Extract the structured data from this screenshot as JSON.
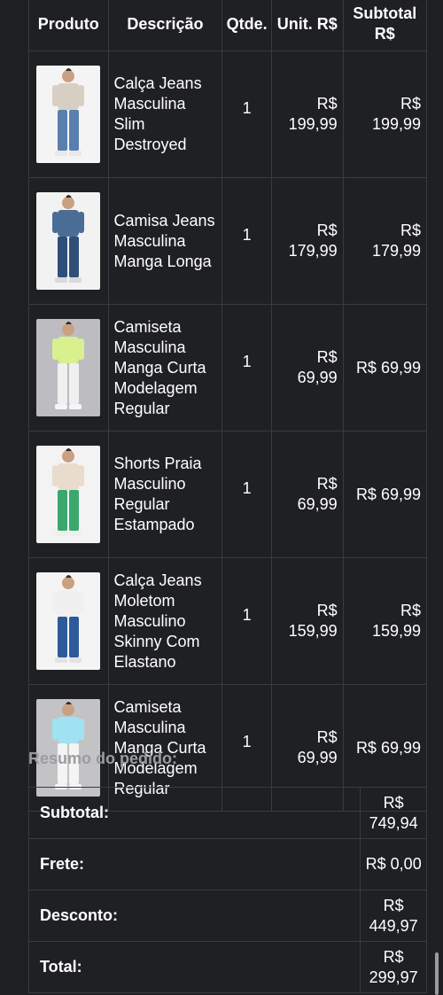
{
  "table": {
    "headers": {
      "product": "Produto",
      "description": "Descrição",
      "quantity": "Qtde.",
      "unit": "Unit. R$",
      "subtotal": "Subtotal R$"
    },
    "rows": [
      {
        "description": "Calça Jeans Masculina Slim Destroyed",
        "quantity": "1",
        "unit": "R$ 199,99",
        "subtotal": "R$ 199,99",
        "thumb": {
          "bg": "#f4f4f4",
          "top": "#d8cfc4",
          "bottom": "#5a7fae",
          "shoes": "#e8e8e8"
        }
      },
      {
        "description": "Camisa Jeans Masculina Manga Longa",
        "quantity": "1",
        "unit": "R$ 179,99",
        "subtotal": "R$ 179,99",
        "thumb": {
          "bg": "#f2f2f2",
          "top": "#4a6d95",
          "bottom": "#2f4f7a",
          "shoes": "#d9d9d9"
        }
      },
      {
        "description": "Camiseta Masculina Manga Curta Modelagem Regular",
        "quantity": "1",
        "unit": "R$ 69,99",
        "subtotal": "R$ 69,99",
        "thumb": {
          "bg": "#bdbdc1",
          "top": "#d9f08f",
          "bottom": "#f0f0f0",
          "shoes": "#f5f5f5"
        }
      },
      {
        "description": "Shorts Praia Masculino Regular Estampado",
        "quantity": "1",
        "unit": "R$ 69,99",
        "subtotal": "R$ 69,99",
        "thumb": {
          "bg": "#f3f3f3",
          "top": "#e9dccd",
          "bottom": "#3aa86c",
          "shoes": "#eeeeee"
        }
      },
      {
        "description": "Calça Jeans Moletom Masculino Skinny Com Elastano",
        "quantity": "1",
        "unit": "R$ 159,99",
        "subtotal": "R$ 159,99",
        "thumb": {
          "bg": "#f4f4f4",
          "top": "#f0f0f0",
          "bottom": "#2e5a9c",
          "shoes": "#e3e3e3"
        }
      },
      {
        "description": "Camiseta Masculina Manga Curta Modelagem Regular",
        "quantity": "1",
        "unit": "R$ 69,99",
        "subtotal": "R$ 69,99",
        "thumb": {
          "bg": "#c3c3c6",
          "top": "#9fe3f2",
          "bottom": "#f4f4f4",
          "shoes": "#f5f5f5"
        }
      }
    ]
  },
  "summary": {
    "title": "Resumo do pedido:",
    "rows": [
      {
        "label": "Subtotal:",
        "value": "R$ 749,94"
      },
      {
        "label": "Frete:",
        "value": "R$ 0,00"
      },
      {
        "label": "Desconto:",
        "value": "R$ 449,97"
      },
      {
        "label": "Total:",
        "value": "R$ 299,97"
      }
    ]
  }
}
